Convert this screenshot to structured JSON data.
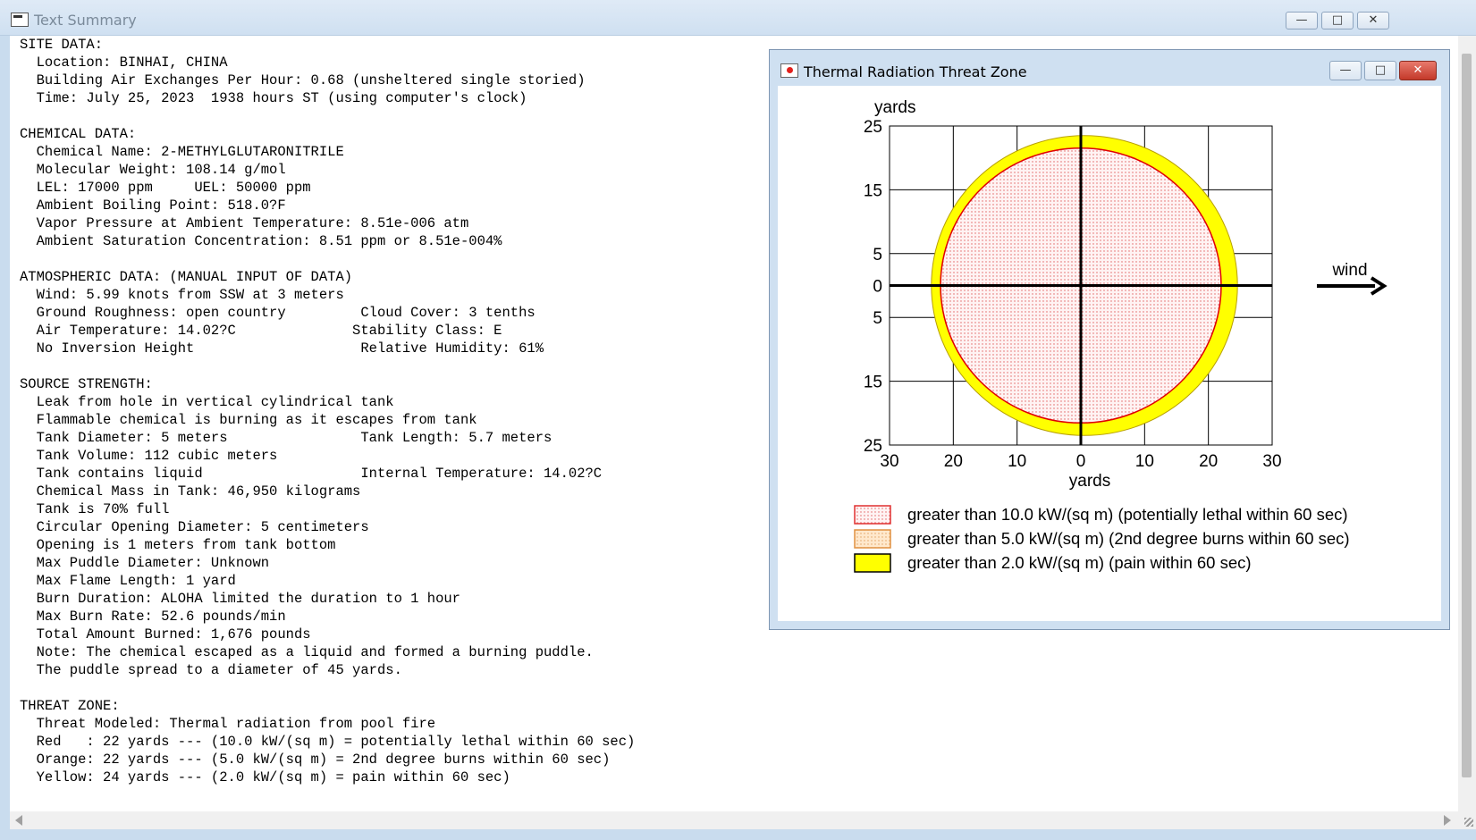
{
  "window": {
    "title": "Text Summary",
    "minimize": "—",
    "maximize": "□",
    "close": "✕"
  },
  "summary_lines": [
    "SITE DATA:",
    "  Location: BINHAI, CHINA",
    "  Building Air Exchanges Per Hour: 0.68 (unsheltered single storied)",
    "  Time: July 25, 2023  1938 hours ST (using computer's clock)",
    "",
    "CHEMICAL DATA:",
    "  Chemical Name: 2-METHYLGLUTARONITRILE",
    "  Molecular Weight: 108.14 g/mol",
    "  LEL: 17000 ppm     UEL: 50000 ppm",
    "  Ambient Boiling Point: 518.0?F",
    "  Vapor Pressure at Ambient Temperature: 8.51e-006 atm",
    "  Ambient Saturation Concentration: 8.51 ppm or 8.51e-004%",
    "",
    "ATMOSPHERIC DATA: (MANUAL INPUT OF DATA)",
    "  Wind: 5.99 knots from SSW at 3 meters",
    "  Ground Roughness: open country         Cloud Cover: 3 tenths",
    "  Air Temperature: 14.02?C              Stability Class: E",
    "  No Inversion Height                    Relative Humidity: 61%",
    "",
    "SOURCE STRENGTH:",
    "  Leak from hole in vertical cylindrical tank",
    "  Flammable chemical is burning as it escapes from tank",
    "  Tank Diameter: 5 meters                Tank Length: 5.7 meters",
    "  Tank Volume: 112 cubic meters",
    "  Tank contains liquid                   Internal Temperature: 14.02?C",
    "  Chemical Mass in Tank: 46,950 kilograms",
    "  Tank is 70% full",
    "  Circular Opening Diameter: 5 centimeters",
    "  Opening is 1 meters from tank bottom",
    "  Max Puddle Diameter: Unknown",
    "  Max Flame Length: 1 yard",
    "  Burn Duration: ALOHA limited the duration to 1 hour",
    "  Max Burn Rate: 52.6 pounds/min",
    "  Total Amount Burned: 1,676 pounds",
    "  Note: The chemical escaped as a liquid and formed a burning puddle.",
    "  The puddle spread to a diameter of 45 yards.",
    "",
    "THREAT ZONE:",
    "  Threat Modeled: Thermal radiation from pool fire",
    "  Red   : 22 yards --- (10.0 kW/(sq m) = potentially lethal within 60 sec)",
    "  Orange: 22 yards --- (5.0 kW/(sq m) = 2nd degree burns within 60 sec)",
    "  Yellow: 24 yards --- (2.0 kW/(sq m) = pain within 60 sec)"
  ],
  "plot_window": {
    "title": "Thermal Radiation Threat Zone",
    "minimize": "—",
    "maximize": "□",
    "close": "✕"
  },
  "chart_data": {
    "type": "scatter",
    "xlabel": "yards",
    "ylabel": "yards",
    "xlim": [
      -30,
      30
    ],
    "ylim": [
      -25,
      25
    ],
    "x_ticks": [
      "30",
      "20",
      "10",
      "0",
      "10",
      "20",
      "30"
    ],
    "y_ticks": [
      "25",
      "15",
      "5",
      "0",
      "5",
      "15",
      "25"
    ],
    "grid": true,
    "zones": [
      {
        "radius": 24,
        "color": "#ffff00",
        "label": "greater than 2.0 kW/(sq m) (pain within 60 sec)"
      },
      {
        "radius": 22,
        "color": "#ffc080",
        "label": "greater than 5.0 kW/(sq m) (2nd degree burns within 60 sec)"
      },
      {
        "radius": 22,
        "color": "#ffd6d6",
        "label": "greater than 10.0 kW/(sq m) (potentially lethal within 60 sec)"
      }
    ],
    "wind_label": "wind",
    "legend_order": [
      2,
      1,
      0
    ]
  }
}
